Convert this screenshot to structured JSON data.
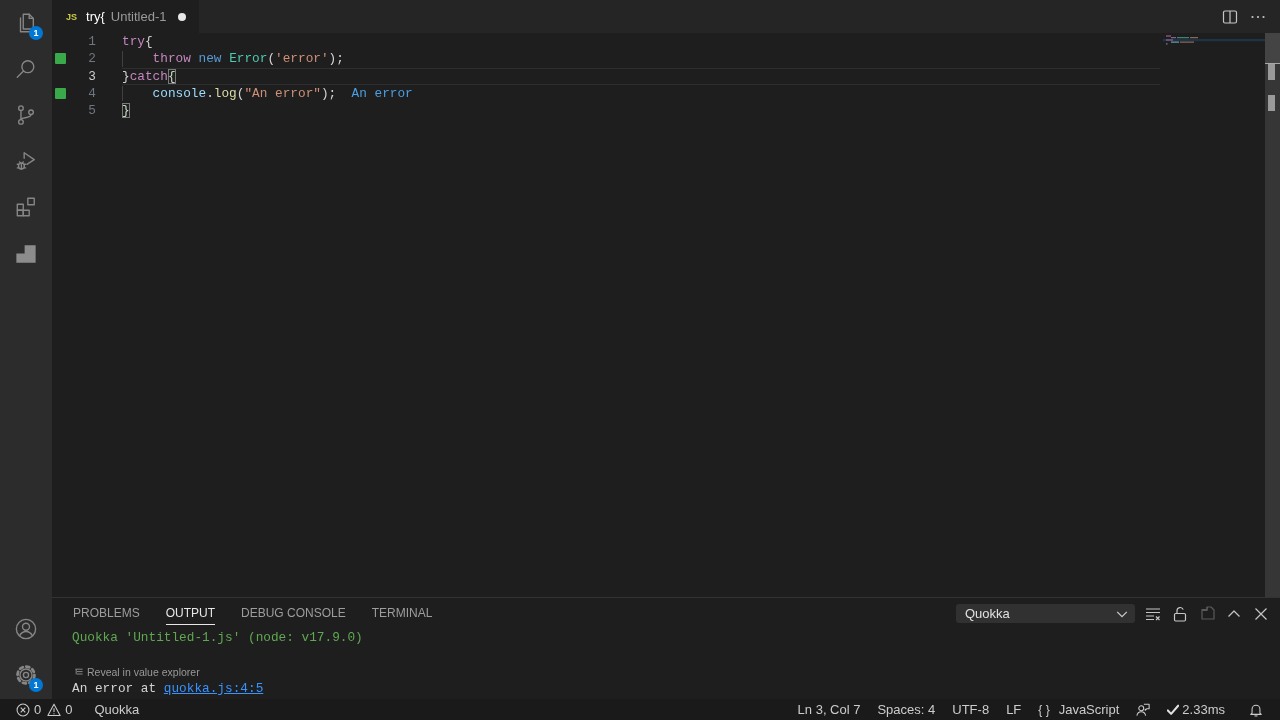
{
  "activity_bar": {
    "items": [
      {
        "kind": "explorer",
        "selected": false,
        "badge": "1"
      },
      {
        "kind": "search",
        "selected": false
      },
      {
        "kind": "source_control",
        "selected": false
      },
      {
        "kind": "run_debug",
        "selected": false
      },
      {
        "kind": "extensions",
        "selected": false
      },
      {
        "kind": "quokka",
        "selected": false
      }
    ],
    "bottom_items": [
      {
        "kind": "accounts"
      },
      {
        "kind": "manage",
        "badge": "1"
      }
    ]
  },
  "editor": {
    "tabs": [
      {
        "icon_label": "JS",
        "title": "try{",
        "description": "Untitled-1",
        "dirty": true,
        "selected": true
      }
    ],
    "lines": [
      {
        "number": "1",
        "marker": false,
        "current": false,
        "indented": false,
        "tokens": [
          {
            "text": "try",
            "kind": "keyword",
            "matched": false
          },
          {
            "text": "{",
            "kind": "punct",
            "matched": false
          }
        ]
      },
      {
        "number": "2",
        "marker": true,
        "current": false,
        "indented": true,
        "tokens": [
          {
            "text": "throw ",
            "kind": "keyword",
            "matched": false
          },
          {
            "text": "new ",
            "kind": "storage",
            "matched": false
          },
          {
            "text": "Error",
            "kind": "type",
            "matched": false
          },
          {
            "text": "(",
            "kind": "punct",
            "matched": false
          },
          {
            "text": "'error'",
            "kind": "string",
            "matched": false
          },
          {
            "text": ");",
            "kind": "punct",
            "matched": false
          }
        ]
      },
      {
        "number": "3",
        "marker": false,
        "current": true,
        "indented": false,
        "tokens": [
          {
            "text": "}",
            "kind": "punct",
            "matched": false
          },
          {
            "text": "catch",
            "kind": "keyword",
            "matched": false
          },
          {
            "text": "{",
            "kind": "punct",
            "matched": true
          }
        ]
      },
      {
        "number": "4",
        "marker": true,
        "current": false,
        "indented": true,
        "tokens": [
          {
            "text": "console",
            "kind": "variable",
            "matched": false
          },
          {
            "text": ".",
            "kind": "punct",
            "matched": false
          },
          {
            "text": "log",
            "kind": "function",
            "matched": false
          },
          {
            "text": "(",
            "kind": "punct",
            "matched": false
          },
          {
            "text": "\"An error\"",
            "kind": "string",
            "matched": false
          },
          {
            "text": ");",
            "kind": "punct",
            "matched": false
          }
        ],
        "inline_result": "An error"
      },
      {
        "number": "5",
        "marker": false,
        "current": false,
        "indented": false,
        "tokens": [
          {
            "text": "}",
            "kind": "punct",
            "matched": true
          }
        ]
      }
    ]
  },
  "panel": {
    "tabs": [
      {
        "label": "PROBLEMS",
        "selected": false
      },
      {
        "label": "OUTPUT",
        "selected": true
      },
      {
        "label": "DEBUG CONSOLE",
        "selected": false
      },
      {
        "label": "TERMINAL",
        "selected": false
      }
    ],
    "channel": "Quokka",
    "actions": [
      {
        "kind": "clear",
        "disabled": false
      },
      {
        "kind": "lock",
        "disabled": false
      },
      {
        "kind": "open_editor",
        "disabled": true
      },
      {
        "kind": "maximize",
        "disabled": false
      },
      {
        "kind": "close",
        "disabled": false
      }
    ],
    "output": [
      {
        "kind": "log",
        "text": "Quokka 'Untitled-1.js' (node: v17.9.0)"
      },
      {
        "kind": "codelens",
        "text": "Reveal in value explorer"
      },
      {
        "kind": "message",
        "text": "An error at",
        "link": "quokka.js:4:5"
      }
    ]
  },
  "status_bar": {
    "errors": "0",
    "warnings": "0",
    "left_items": [
      "Quokka"
    ],
    "right_items": [
      "Ln 3, Col 7",
      "Spaces: 4",
      "UTF-8",
      "LF"
    ],
    "language_icon": "{ }",
    "language": "JavaScript",
    "run_time": "2.33ms"
  }
}
